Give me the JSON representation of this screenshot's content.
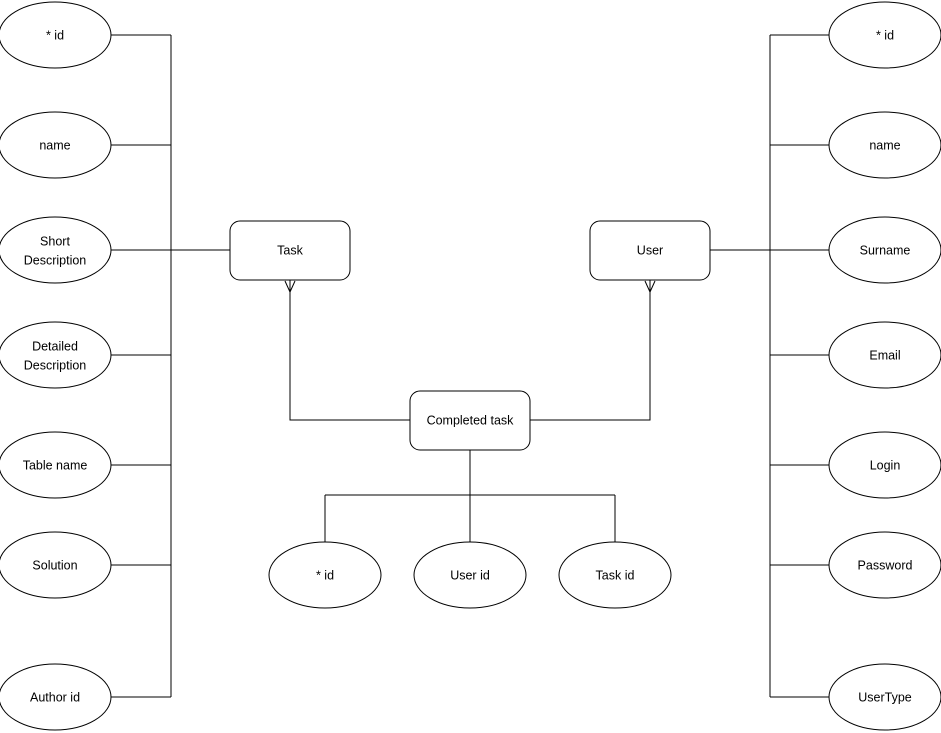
{
  "diagram": {
    "type": "entity-relationship-diagram",
    "background_color": "#ffffff",
    "stroke_color": "#000000",
    "entities": [
      {
        "id": "task",
        "label": "Task"
      },
      {
        "id": "user",
        "label": "User"
      },
      {
        "id": "completed_task",
        "label": "Completed task"
      }
    ],
    "attributes": {
      "task": [
        {
          "id": "task_id",
          "label": "* id",
          "line1": "* id",
          "line2": ""
        },
        {
          "id": "task_name",
          "label": "name",
          "line1": "name",
          "line2": ""
        },
        {
          "id": "task_shortdesc",
          "label": "Short Description",
          "line1": "Short",
          "line2": "Description"
        },
        {
          "id": "task_longdesc",
          "label": "Detailed Description",
          "line1": "Detailed",
          "line2": "Description"
        },
        {
          "id": "task_tablename",
          "label": "Table name",
          "line1": "Table name",
          "line2": ""
        },
        {
          "id": "task_solution",
          "label": "Solution",
          "line1": "Solution",
          "line2": ""
        },
        {
          "id": "task_authorid",
          "label": "Author id",
          "line1": "Author id",
          "line2": ""
        }
      ],
      "user": [
        {
          "id": "user_id",
          "label": "* id",
          "line1": "* id",
          "line2": ""
        },
        {
          "id": "user_name",
          "label": "name",
          "line1": "name",
          "line2": ""
        },
        {
          "id": "user_surname",
          "label": "Surname",
          "line1": "Surname",
          "line2": ""
        },
        {
          "id": "user_email",
          "label": "Email",
          "line1": "Email",
          "line2": ""
        },
        {
          "id": "user_login",
          "label": "Login",
          "line1": "Login",
          "line2": ""
        },
        {
          "id": "user_password",
          "label": "Password",
          "line1": "Password",
          "line2": ""
        },
        {
          "id": "user_usertype",
          "label": "UserType",
          "line1": "UserType",
          "line2": ""
        }
      ],
      "completed_task": [
        {
          "id": "ct_id",
          "label": "* id",
          "line1": "* id",
          "line2": ""
        },
        {
          "id": "ct_userid",
          "label": "User id",
          "line1": "User id",
          "line2": ""
        },
        {
          "id": "ct_taskid",
          "label": "Task id",
          "line1": "Task id",
          "line2": ""
        }
      ]
    },
    "relationships": [
      {
        "from": "task",
        "to": "completed_task",
        "marker": "open-arrow"
      },
      {
        "from": "user",
        "to": "completed_task",
        "marker": "open-arrow"
      }
    ]
  }
}
